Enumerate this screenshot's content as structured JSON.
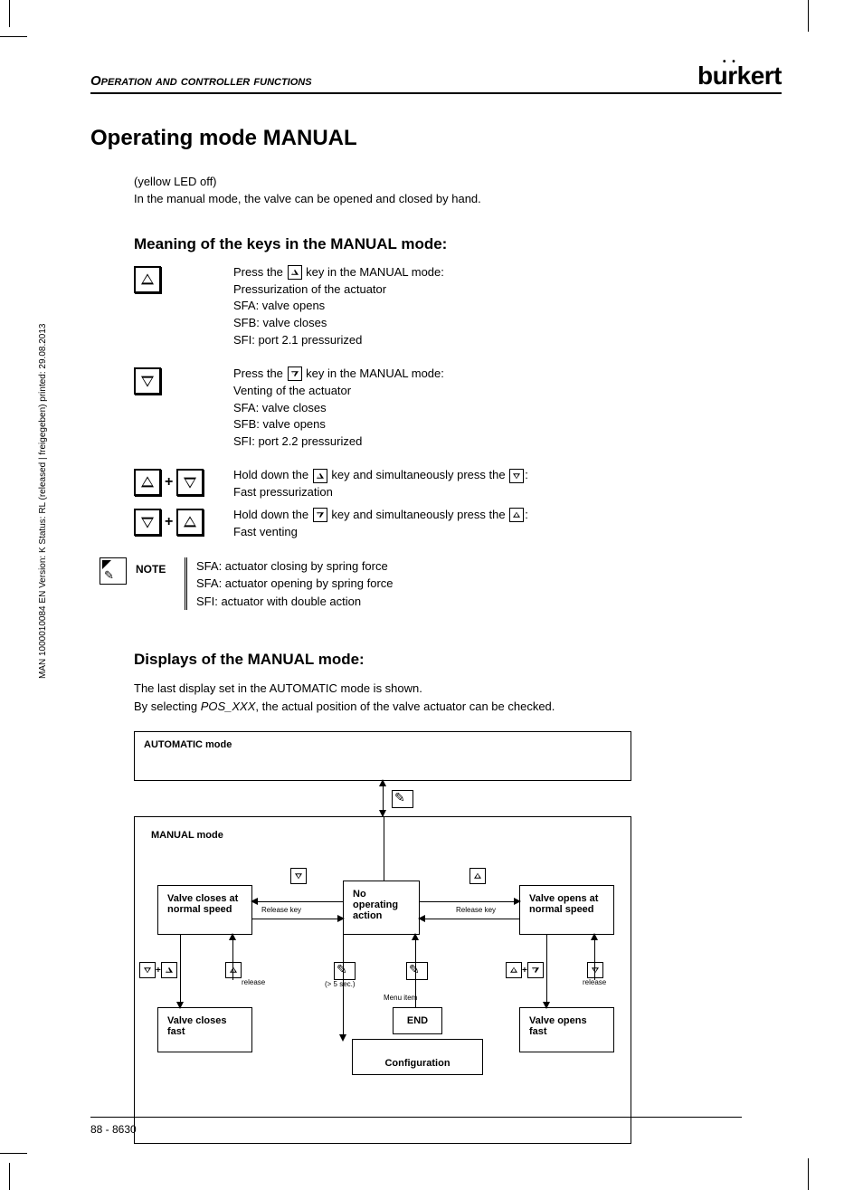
{
  "header": {
    "section": "Operation and controller functions",
    "brand": "burkert"
  },
  "title": "Operating mode MANUAL",
  "intro": {
    "line1": "(yellow LED off)",
    "line2": "In the manual mode, the valve can be opened and closed by hand."
  },
  "keys_heading": "Meaning of the keys in the MANUAL mode:",
  "up_block": {
    "l1": "Press the",
    "l1b": "key in the MANUAL mode:",
    "l2": "Pressurization of the actuator",
    "l3": "SFA:  valve opens",
    "l4": "SFB:  valve closes",
    "l5": "SFI:   port 2.1 pressurized"
  },
  "down_block": {
    "l1": "Press the",
    "l1b": "key in the MANUAL mode:",
    "l2": "Venting of the actuator",
    "l3": "SFA:  valve closes",
    "l4": "SFB:  valve opens",
    "l5": "SFI:   port 2.2 pressurized"
  },
  "combo1": {
    "l1": "Hold down the",
    "l1b": "key and simultaneously press the",
    "l1c": ":",
    "l2": "Fast pressurization"
  },
  "combo2": {
    "l1": "Hold down the",
    "l1b": "key and simultaneously press the",
    "l1c": ":",
    "l2": "Fast venting"
  },
  "note": {
    "label": "NOTE",
    "l1": "SFA:  actuator closing by spring force",
    "l2": "SFA:  actuator opening by spring force",
    "l3": "SFI:   actuator with double action"
  },
  "displays_heading": "Displays of the MANUAL mode:",
  "displays_text": {
    "l1": "The last display set in the AUTOMATIC mode is shown.",
    "l2a": "By selecting ",
    "l2b": "POS_XXX",
    "l2c": ", the actual position of the valve actuator can be checked."
  },
  "diagram": {
    "automatic": "AUTOMATIC mode",
    "manual": "MANUAL mode",
    "closes_normal": "Valve closes at normal speed",
    "no_action": "No operating action",
    "opens_normal": "Valve opens at normal speed",
    "closes_fast": "Valve closes fast",
    "end": "END",
    "config": "Configuration",
    "opens_fast": "Valve opens fast",
    "release_key": "Release key",
    "release": "release",
    "menu_item": "Menu item",
    "five_sec": "(> 5 sec.)"
  },
  "side": "MAN 1000010084 EN Version: K Status: RL (released | freigegeben) printed: 29.08.2013",
  "footer": "88   -   8630"
}
